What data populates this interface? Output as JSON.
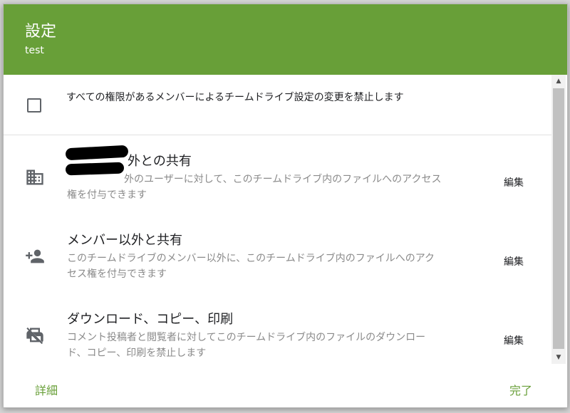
{
  "colors": {
    "header_bg": "#689f38",
    "accent": "#689f38",
    "secondary_text": "#8a8a8a"
  },
  "header": {
    "title": "設定",
    "subtitle": "test"
  },
  "restriction": {
    "checked": false,
    "label": "すべての権限があるメンバーによるチームドライブ設定の変更を禁止します"
  },
  "settings": [
    {
      "icon": "building-icon",
      "title": "外との共有",
      "description": "外のユーザーに対して、このチームドライブ内のファイルへのアクセス権を付与できます",
      "edit_label": "編集"
    },
    {
      "icon": "add-person-icon",
      "title": "メンバー以外と共有",
      "description": "このチームドライブのメンバー以外に、このチームドライブ内のファイルへのアクセス権を付与できます",
      "edit_label": "編集"
    },
    {
      "icon": "download-off-icon",
      "title": "ダウンロード、コピー、印刷",
      "description": "コメント投稿者と閲覧者に対してこのチームドライブ内のファイルのダウンロード、コピー、印刷を禁止します",
      "edit_label": "編集"
    }
  ],
  "footer": {
    "details_label": "詳細",
    "done_label": "完了"
  }
}
